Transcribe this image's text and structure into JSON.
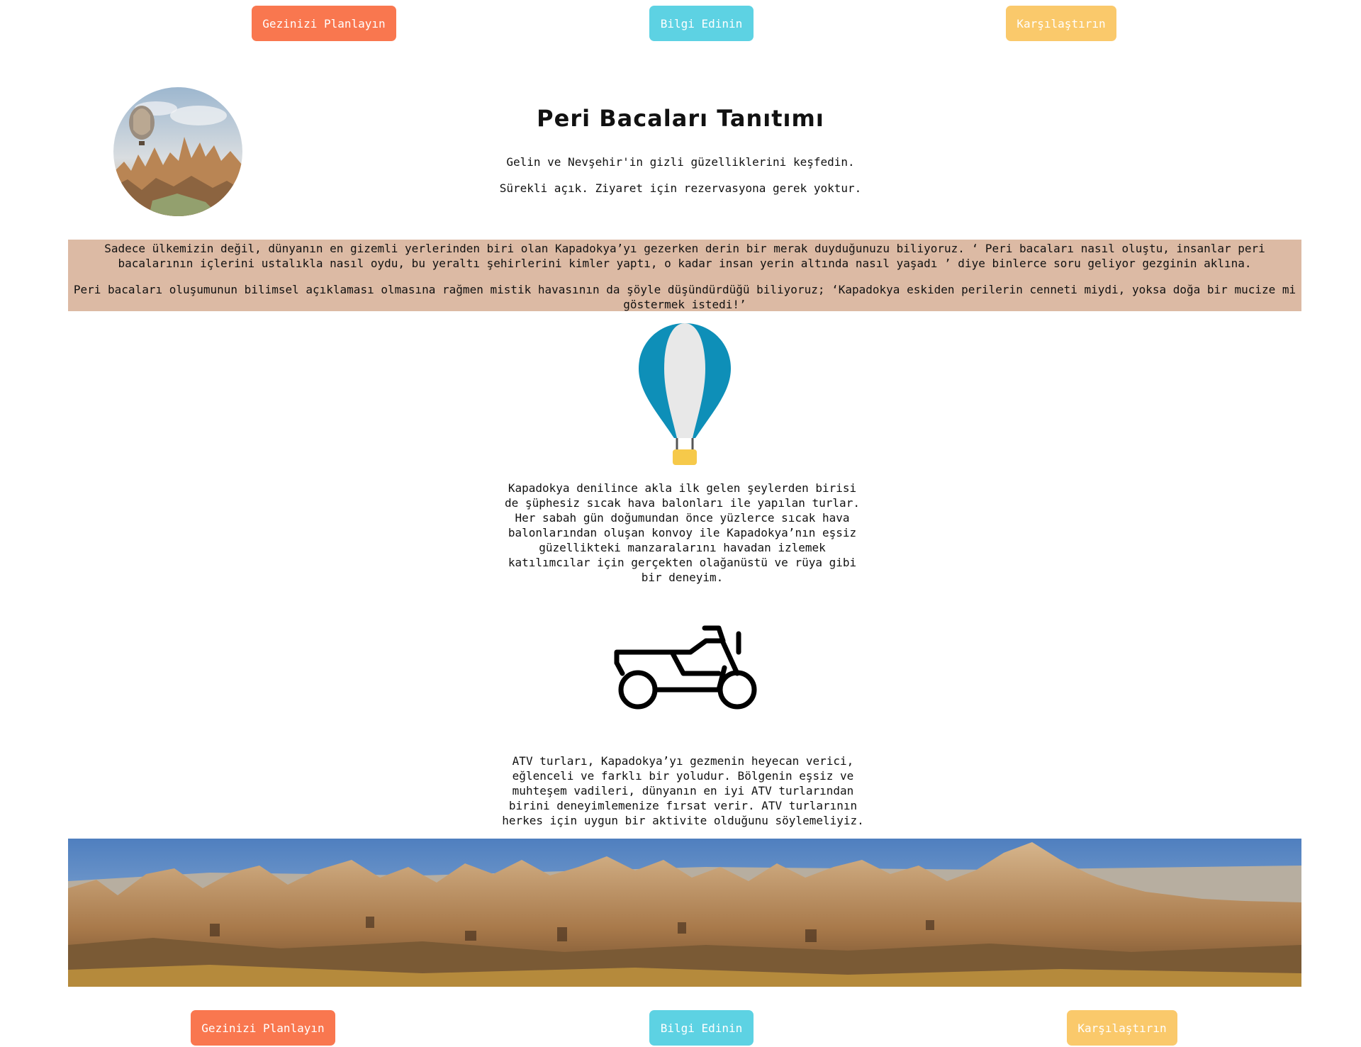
{
  "nav_top": {
    "plan_label": "Gezinizi Planlayın",
    "info_label": "Bilgi Edinin",
    "compare_label": "Karşılaştırın"
  },
  "header": {
    "title": "Peri Bacaları Tanıtımı",
    "subtitle": "Gelin ve Nevşehir'in gizli güzelliklerini keşfedin.",
    "notice": "Sürekli açık. Ziyaret için rezervasyona gerek yoktur."
  },
  "intro": {
    "paragraph_1": "Sadece ülkemizin değil, dünyanın en gizemli yerlerinden biri olan Kapadokya’yı gezerken derin bir merak duyduğunuzu biliyoruz. ‘ Peri bacaları nasıl oluştu, insanlar peri bacalarının içlerini ustalıkla nasıl oydu, bu yeraltı şehirlerini kimler yaptı, o kadar insan yerin altında nasıl yaşadı ’ diye binlerce soru geliyor gezginin aklına.",
    "paragraph_2": "Peri bacaları oluşumunun bilimsel açıklaması olmasına rağmen mistik havasının da şöyle düşündürdüğü biliyoruz; ‘Kapadokya eskiden perilerin cenneti miydi, yoksa doğa bir mucize mi göstermek istedi!’"
  },
  "balloon_section": {
    "text": "Kapadokya denilince akla ilk gelen şeylerden birisi de şüphesiz sıcak hava balonları ile yapılan turlar. Her sabah gün doğumundan önce yüzlerce sıcak hava balonlarından oluşan konvoy ile Kapadokya’nın eşsiz güzellikteki manzaralarını havadan izlemek katılımcılar için gerçekten olağanüstü ve rüya gibi bir deneyim."
  },
  "atv_section": {
    "text": "ATV turları, Kapadokya’yı gezmenin heyecan verici, eğlenceli ve farklı bir yoludur. Bölgenin eşsiz ve muhteşem vadileri, dünyanın en iyi ATV turlarından birini deneyimlemenize fırsat verir. ATV turlarının herkes için uygun bir aktivite olduğunu söylemeliyiz."
  },
  "nav_bottom": {
    "plan_label": "Gezinizi Planlayın",
    "info_label": "Bilgi Edinin",
    "compare_label": "Karşılaştırın"
  },
  "icons": {
    "avatar": "cappadocia-balloon-photo",
    "balloon": "hot-air-balloon-icon",
    "atv": "atv-quad-bike-icon",
    "panorama": "fairy-chimneys-panorama"
  },
  "colors": {
    "orange": "#f9774f",
    "cyan": "#5dd2e3",
    "yellow": "#fac96b",
    "intro_bg": "#dcbaa4",
    "balloon_blue": "#0e8fb8",
    "balloon_basket": "#f6c94a"
  }
}
